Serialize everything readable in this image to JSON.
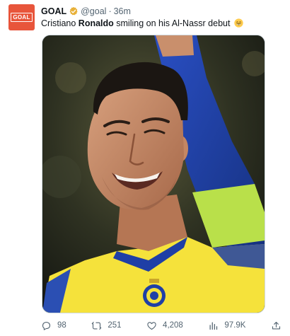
{
  "tweet": {
    "avatar_text": "GOAL",
    "author_name": "GOAL",
    "handle": "@goal",
    "separator": "·",
    "time": "36m",
    "text_before": "Cristiano ",
    "text_bold": "Ronaldo",
    "text_after": " smiling on his Al-Nassr debut",
    "emoji": "grinning-face-with-smiling-eyes"
  },
  "actions": {
    "replies": "98",
    "retweets": "251",
    "likes": "4,208",
    "views": "97.9K"
  },
  "colors": {
    "brand": "#e8553b",
    "verified": "#e8b13a",
    "text": "#0f1419",
    "muted": "#536471",
    "kit_yellow": "#f5e23b",
    "kit_blue": "#1f3fa6"
  },
  "icons": {
    "verified": "verified-badge-icon",
    "reply": "reply-icon",
    "retweet": "retweet-icon",
    "like": "heart-icon",
    "views": "analytics-icon",
    "share": "share-icon"
  }
}
